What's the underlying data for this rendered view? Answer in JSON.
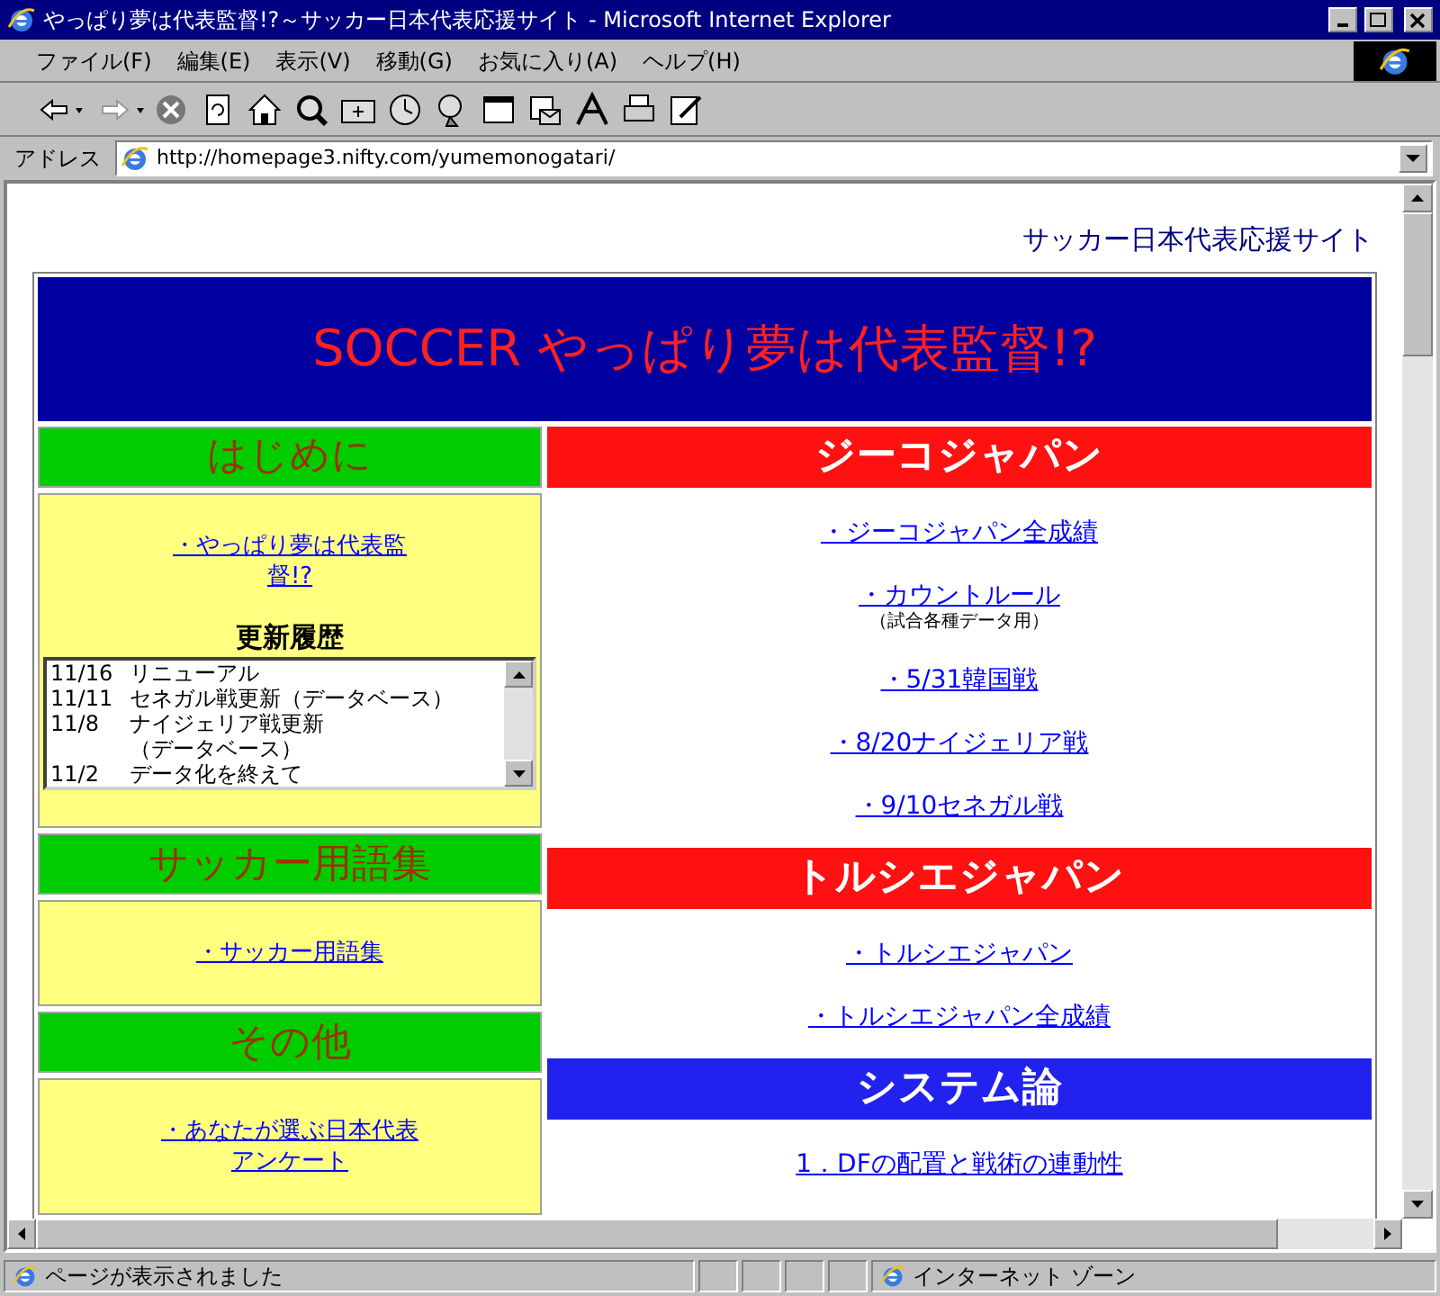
{
  "window": {
    "title": "やっぱり夢は代表監督!?～サッカー日本代表応援サイト - Microsoft Internet Explorer"
  },
  "menu": [
    "ファイル(F)",
    "編集(E)",
    "表示(V)",
    "移動(G)",
    "お気に入り(A)",
    "ヘルプ(H)"
  ],
  "address": {
    "label": "アドレス",
    "value": "http://homepage3.nifty.com/yumemonogatari/"
  },
  "page": {
    "site_label": "サッカー日本代表応援サイト",
    "banner": "SOCCER やっぱり夢は代表監督!?",
    "left_sections": [
      {
        "heading": "はじめに",
        "links": [
          "・やっぱり夢は代表監督!?"
        ],
        "history": {
          "title": "更新履歴",
          "entries": [
            {
              "date": "11/16",
              "lines": [
                "リニューアル"
              ]
            },
            {
              "date": "11/11",
              "lines": [
                "セネガル戦更新（データベース）"
              ]
            },
            {
              "date": "11/8",
              "lines": [
                "ナイジェリア戦更新",
                "（データベース）"
              ]
            },
            {
              "date": "11/2",
              "lines": [
                "データ化を終えて"
              ]
            }
          ]
        }
      },
      {
        "heading": "サッカー用語集",
        "links": [
          "・サッカー用語集"
        ]
      },
      {
        "heading": "その他",
        "links": [
          "・あなたが選ぶ日本代表アンケート"
        ]
      }
    ],
    "right_sections": [
      {
        "heading": "ジーコジャパン",
        "color": "#ff1111",
        "links": [
          {
            "text": "・ジーコジャパン全成績"
          },
          {
            "text": "・カウントルール",
            "note": "（試合各種データ用）"
          },
          {
            "text": "・5/31韓国戦"
          },
          {
            "text": "・8/20ナイジェリア戦"
          },
          {
            "text": "・9/10セネガル戦"
          }
        ]
      },
      {
        "heading": "トルシエジャパン",
        "color": "#ff1111",
        "links": [
          {
            "text": "・トルシエジャパン"
          },
          {
            "text": "・トルシエジャパン全成績"
          }
        ]
      },
      {
        "heading": "システム論",
        "color": "#2222ee",
        "links": [
          {
            "text": "1．DFの配置と戦術の連動性"
          }
        ]
      }
    ]
  },
  "status_bar": {
    "message": "ページが表示されました",
    "zone": "インターネット ゾーン"
  }
}
